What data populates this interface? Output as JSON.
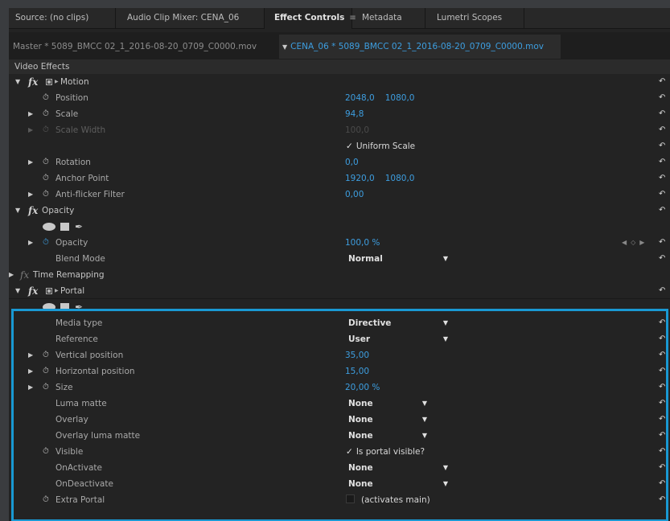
{
  "tabs": [
    {
      "label": "Source: (no clips)"
    },
    {
      "label": "Audio Clip Mixer: CENA_06"
    },
    {
      "label": "Effect Controls",
      "menu": "≡",
      "active": true
    },
    {
      "label": "Metadata"
    },
    {
      "label": "Lumetri Scopes"
    }
  ],
  "clip_bar": {
    "master_clip": "Master * 5089_BMCC 02_1_2016-08-20_0709_C0000.mov",
    "sequence_clip": "CENA_06 * 5089_BMCC 02_1_2016-08-20_0709_C0000.mov"
  },
  "section_label": "Video Effects",
  "motion": {
    "name": "Motion",
    "position": {
      "label": "Position",
      "x": "2048,0",
      "y": "1080,0"
    },
    "scale": {
      "label": "Scale",
      "value": "94,8"
    },
    "scale_width": {
      "label": "Scale Width",
      "value": "100,0"
    },
    "uniform_scale": {
      "label": "Uniform Scale"
    },
    "rotation": {
      "label": "Rotation",
      "value": "0,0"
    },
    "anchor_point": {
      "label": "Anchor Point",
      "x": "1920,0",
      "y": "1080,0"
    },
    "anti_flicker": {
      "label": "Anti-flicker Filter",
      "value": "0,00"
    }
  },
  "opacity": {
    "name": "Opacity",
    "opacity": {
      "label": "Opacity",
      "value": "100,0 %"
    },
    "blend_mode": {
      "label": "Blend Mode",
      "value": "Normal"
    }
  },
  "time_remapping": {
    "name": "Time Remapping"
  },
  "portal": {
    "name": "Portal",
    "media_type": {
      "label": "Media type",
      "value": "Directive"
    },
    "reference": {
      "label": "Reference",
      "value": "User"
    },
    "vertical_position": {
      "label": "Vertical position",
      "value": "35,00"
    },
    "horizontal_position": {
      "label": "Horizontal position",
      "value": "15,00"
    },
    "size": {
      "label": "Size",
      "value": "20,00 %"
    },
    "luma_matte": {
      "label": "Luma matte",
      "value": "None"
    },
    "overlay": {
      "label": "Overlay",
      "value": "None"
    },
    "overlay_luma_matte": {
      "label": "Overlay luma matte",
      "value": "None"
    },
    "visible": {
      "label": "Visible",
      "checkbox_label": "Is portal visible?"
    },
    "on_activate": {
      "label": "OnActivate",
      "value": "None"
    },
    "on_deactivate": {
      "label": "OnDeactivate",
      "value": "None"
    },
    "extra_portal": {
      "label": "Extra Portal",
      "checkbox_label": "(activates main)"
    }
  },
  "colors": {
    "accent_blue": "#3d9ee0",
    "highlight_border": "#1999d3",
    "panel_bg": "#232323"
  },
  "icons": {
    "expand": "triangle-down",
    "collapse": "triangle-right",
    "stopwatch": "stopwatch-icon",
    "reset": "reset-icon",
    "fx": "fx-badge"
  }
}
